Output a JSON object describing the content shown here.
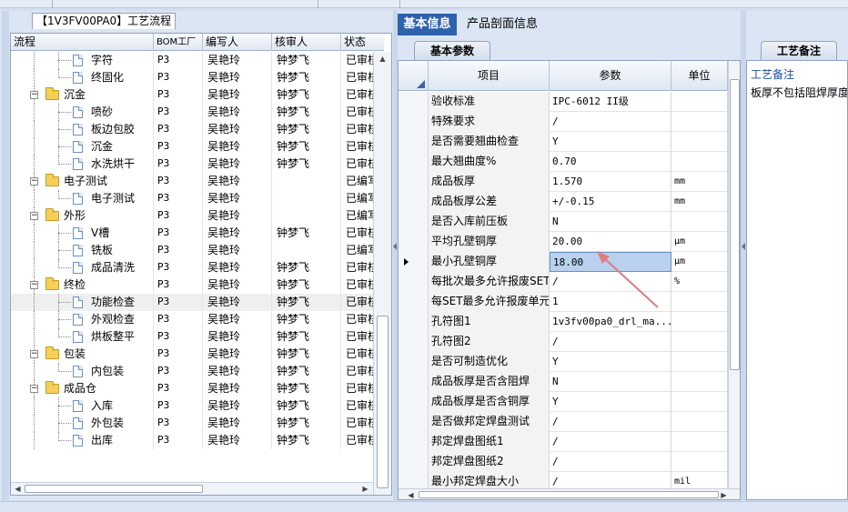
{
  "left_panel": {
    "title": "【1V3FV00PA0】工艺流程",
    "columns": [
      "流程",
      "BOM工厂",
      "编写人",
      "核审人",
      "状态"
    ],
    "rows": [
      {
        "level": 2,
        "name": "字符",
        "factory": "P3",
        "author": "吴艳玲",
        "reviewer": "钟梦飞",
        "status": "已审核"
      },
      {
        "level": 2,
        "name": "终固化",
        "factory": "P3",
        "author": "吴艳玲",
        "reviewer": "钟梦飞",
        "status": "已审核"
      },
      {
        "level": 1,
        "name": "沉金",
        "factory": "P3",
        "author": "吴艳玲",
        "reviewer": "钟梦飞",
        "status": "已审核"
      },
      {
        "level": 2,
        "name": "喷砂",
        "factory": "P3",
        "author": "吴艳玲",
        "reviewer": "钟梦飞",
        "status": "已审核"
      },
      {
        "level": 2,
        "name": "板边包胶",
        "factory": "P3",
        "author": "吴艳玲",
        "reviewer": "钟梦飞",
        "status": "已审核"
      },
      {
        "level": 2,
        "name": "沉金",
        "factory": "P3",
        "author": "吴艳玲",
        "reviewer": "钟梦飞",
        "status": "已审核"
      },
      {
        "level": 2,
        "name": "水洗烘干",
        "factory": "P3",
        "author": "吴艳玲",
        "reviewer": "钟梦飞",
        "status": "已审核"
      },
      {
        "level": 1,
        "name": "电子测试",
        "factory": "P3",
        "author": "吴艳玲",
        "reviewer": "",
        "status": "已编写"
      },
      {
        "level": 2,
        "name": "电子测试",
        "factory": "P3",
        "author": "吴艳玲",
        "reviewer": "",
        "status": "已编写"
      },
      {
        "level": 1,
        "name": "外形",
        "factory": "P3",
        "author": "吴艳玲",
        "reviewer": "",
        "status": "已编写"
      },
      {
        "level": 2,
        "name": "V槽",
        "factory": "P3",
        "author": "吴艳玲",
        "reviewer": "钟梦飞",
        "status": "已审核"
      },
      {
        "level": 2,
        "name": "铣板",
        "factory": "P3",
        "author": "吴艳玲",
        "reviewer": "",
        "status": "已编写"
      },
      {
        "level": 2,
        "name": "成品清洗",
        "factory": "P3",
        "author": "吴艳玲",
        "reviewer": "钟梦飞",
        "status": "已审核"
      },
      {
        "level": 1,
        "name": "终检",
        "factory": "P3",
        "author": "吴艳玲",
        "reviewer": "钟梦飞",
        "status": "已审核"
      },
      {
        "level": 2,
        "name": "功能检查",
        "factory": "P3",
        "author": "吴艳玲",
        "reviewer": "钟梦飞",
        "status": "已审核",
        "selected": true
      },
      {
        "level": 2,
        "name": "外观检查",
        "factory": "P3",
        "author": "吴艳玲",
        "reviewer": "钟梦飞",
        "status": "已审核"
      },
      {
        "level": 2,
        "name": "烘板整平",
        "factory": "P3",
        "author": "吴艳玲",
        "reviewer": "钟梦飞",
        "status": "已审核"
      },
      {
        "level": 1,
        "name": "包装",
        "factory": "P3",
        "author": "吴艳玲",
        "reviewer": "钟梦飞",
        "status": "已审核"
      },
      {
        "level": 2,
        "name": "内包装",
        "factory": "P3",
        "author": "吴艳玲",
        "reviewer": "钟梦飞",
        "status": "已审核"
      },
      {
        "level": 1,
        "name": "成品仓",
        "factory": "P3",
        "author": "吴艳玲",
        "reviewer": "钟梦飞",
        "status": "已审核"
      },
      {
        "level": 2,
        "name": "入库",
        "factory": "P3",
        "author": "吴艳玲",
        "reviewer": "钟梦飞",
        "status": "已审核"
      },
      {
        "level": 2,
        "name": "外包装",
        "factory": "P3",
        "author": "吴艳玲",
        "reviewer": "钟梦飞",
        "status": "已审核"
      },
      {
        "level": 2,
        "name": "出库",
        "factory": "P3",
        "author": "吴艳玲",
        "reviewer": "钟梦飞",
        "status": "已审核"
      }
    ]
  },
  "middle_panel": {
    "tabs": [
      "基本信息",
      "产品剖面信息"
    ],
    "subtab": "基本参数",
    "columns": [
      "项目",
      "参数",
      "单位"
    ],
    "rows": [
      {
        "label": "验收标准",
        "value": "IPC-6012 II级",
        "unit": ""
      },
      {
        "label": "特殊要求",
        "value": "/",
        "unit": ""
      },
      {
        "label": "是否需要翘曲检查",
        "value": "Y",
        "unit": ""
      },
      {
        "label": "最大翘曲度%",
        "value": "0.70",
        "unit": ""
      },
      {
        "label": "成品板厚",
        "value": "1.570",
        "unit": "mm"
      },
      {
        "label": "成品板厚公差",
        "value": "+/-0.15",
        "unit": "mm"
      },
      {
        "label": "是否入库前压板",
        "value": "N",
        "unit": ""
      },
      {
        "label": "平均孔壁铜厚",
        "value": "20.00",
        "unit": "µm"
      },
      {
        "label": "最小孔壁铜厚",
        "value": "18.00",
        "unit": "µm",
        "active": true
      },
      {
        "label": "每批次最多允许报废SET",
        "value": "/",
        "unit": "%"
      },
      {
        "label": "每SET最多允许报废单元",
        "value": "1",
        "unit": ""
      },
      {
        "label": "孔符图1",
        "value": "1v3fv00pa0_drl_ma...",
        "unit": ""
      },
      {
        "label": "孔符图2",
        "value": "/",
        "unit": ""
      },
      {
        "label": "是否可制造优化",
        "value": "Y",
        "unit": ""
      },
      {
        "label": "成品板厚是否含阻焊",
        "value": "N",
        "unit": ""
      },
      {
        "label": "成品板厚是否含铜厚",
        "value": "Y",
        "unit": ""
      },
      {
        "label": "是否做邦定焊盘测试",
        "value": "/",
        "unit": ""
      },
      {
        "label": "邦定焊盘图纸1",
        "value": "/",
        "unit": ""
      },
      {
        "label": "邦定焊盘图纸2",
        "value": "/",
        "unit": ""
      },
      {
        "label": "最小邦定焊盘大小",
        "value": "/",
        "unit": "mil"
      }
    ]
  },
  "right_panel": {
    "subtab": "工艺备注",
    "header": "工艺备注",
    "text": "板厚不包括阻焊厚度"
  },
  "colors": {
    "accent_tab": "#2f62ad",
    "panel_bg": "#dbe5f3",
    "active_cell": "#b9d1ee",
    "annotation_arrow": "#e07b80"
  }
}
